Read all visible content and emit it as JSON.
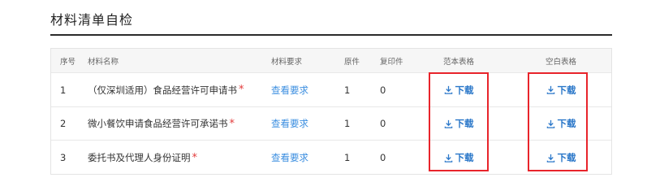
{
  "section": {
    "title": "材料清单自检"
  },
  "table": {
    "columns": {
      "index": "序号",
      "name": "材料名称",
      "requirement": "材料要求",
      "original": "原件",
      "copy": "复印件",
      "sample": "范本表格",
      "blank": "空白表格"
    },
    "rows": [
      {
        "index": "1",
        "name": "（仅深圳适用）食品经营许可申请书",
        "required_mark": "*",
        "requirement": "查看要求",
        "original": "1",
        "copy": "0",
        "sample": "下载",
        "blank": "下载"
      },
      {
        "index": "2",
        "name": "微小餐饮申请食品经营许可承诺书",
        "required_mark": "*",
        "requirement": "查看要求",
        "original": "1",
        "copy": "0",
        "sample": "下载",
        "blank": "下载"
      },
      {
        "index": "3",
        "name": "委托书及代理人身份证明",
        "required_mark": "*",
        "requirement": "查看要求",
        "original": "1",
        "copy": "0",
        "sample": "下载",
        "blank": "下载"
      }
    ]
  },
  "icons": {
    "download": "download-icon"
  },
  "colors": {
    "link": "#3d8fe0",
    "download": "#2a77c9",
    "required": "#e23b3b",
    "highlight": "#e8242b"
  }
}
